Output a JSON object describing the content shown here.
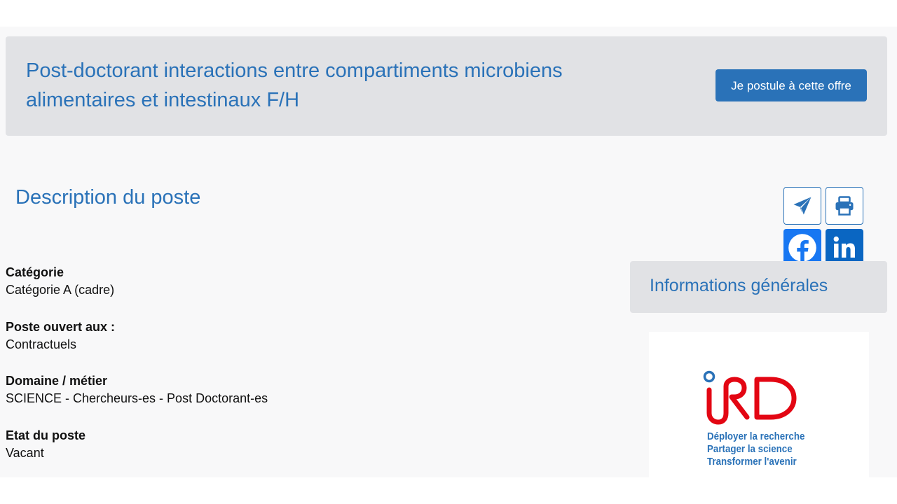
{
  "job": {
    "title": "Post-doctorant interactions entre compartiments microbiens alimentaires et intestinaux F/H",
    "apply_label": "Je postule à cette offre"
  },
  "section": {
    "title": "Description du poste"
  },
  "share": {
    "buttons": [
      {
        "name": "send-email",
        "icon": "paper-plane-icon"
      },
      {
        "name": "print",
        "icon": "printer-icon"
      },
      {
        "name": "facebook",
        "icon": "facebook-icon",
        "color": "#1877f2"
      },
      {
        "name": "linkedin",
        "icon": "linkedin-icon",
        "color": "#0a66c2"
      }
    ]
  },
  "fields": [
    {
      "label": "Catégorie",
      "value": "Catégorie A (cadre)"
    },
    {
      "label": "Poste ouvert aux :",
      "value": "Contractuels"
    },
    {
      "label": "Domaine / métier",
      "value": "SCIENCE - Chercheurs-es - Post Doctorant-es"
    },
    {
      "label": "Etat du poste",
      "value": "Vacant"
    }
  ],
  "sidebar": {
    "title": "Informations générales",
    "logo": {
      "text": "IRD",
      "tagline": [
        "Déployer la recherche",
        "Partager la science",
        "Transformer l'avenir"
      ]
    }
  },
  "colors": {
    "accent": "#2a72b8",
    "panel": "#e1e2e5",
    "logo_red": "#e30613"
  }
}
